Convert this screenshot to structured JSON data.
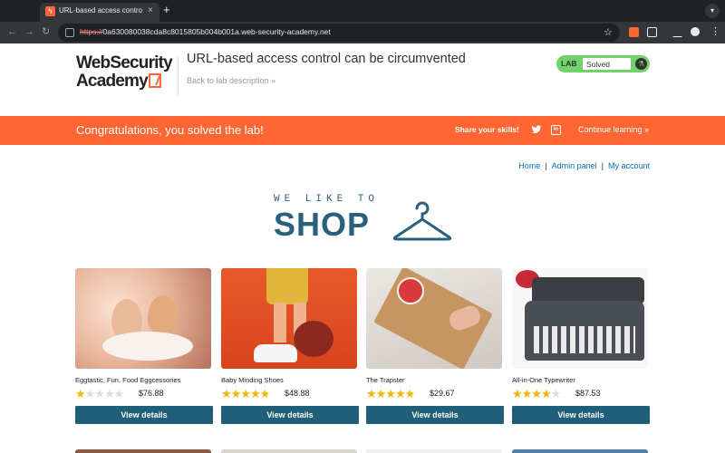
{
  "browser": {
    "tab_title": "URL-based access control ca",
    "tab_close": "×",
    "new_tab": "+",
    "url_scheme": "https://",
    "url_rest": "0a630080038cda8c8015805b004b001a.web-security-academy.net"
  },
  "header": {
    "logo_line1": "WebSecurity",
    "logo_line2": "Academy",
    "lab_title": "URL-based access control can be circumvented",
    "back_link": "Back to lab description",
    "status_lab": "LAB",
    "status_text": "Solved"
  },
  "banner": {
    "message": "Congratulations, you solved the lab!",
    "share": "Share your skills!",
    "continue": "Continue learning"
  },
  "nav": {
    "home": "Home",
    "admin": "Admin panel",
    "account": "My account",
    "separator": "|"
  },
  "hero": {
    "small": "WE LIKE TO",
    "big": "SHOP"
  },
  "products": [
    {
      "name": "Eggtastic, Fun, Food Eggcessories",
      "rating": 1,
      "price": "$76.88",
      "button": "View details"
    },
    {
      "name": "Baby Minding Shoes",
      "rating": 5,
      "price": "$48.88",
      "button": "View details"
    },
    {
      "name": "The Trapster",
      "rating": 5,
      "price": "$29.67",
      "button": "View details"
    },
    {
      "name": "All-in-One Typewriter",
      "rating": 4,
      "price": "$87.53",
      "button": "View details"
    }
  ],
  "colors": {
    "brand_orange": "#ff6633",
    "solved_green": "#70d16d",
    "button_blue": "#1f5f7a",
    "shop_blue": "#29607d",
    "star_gold": "#f4b400"
  }
}
